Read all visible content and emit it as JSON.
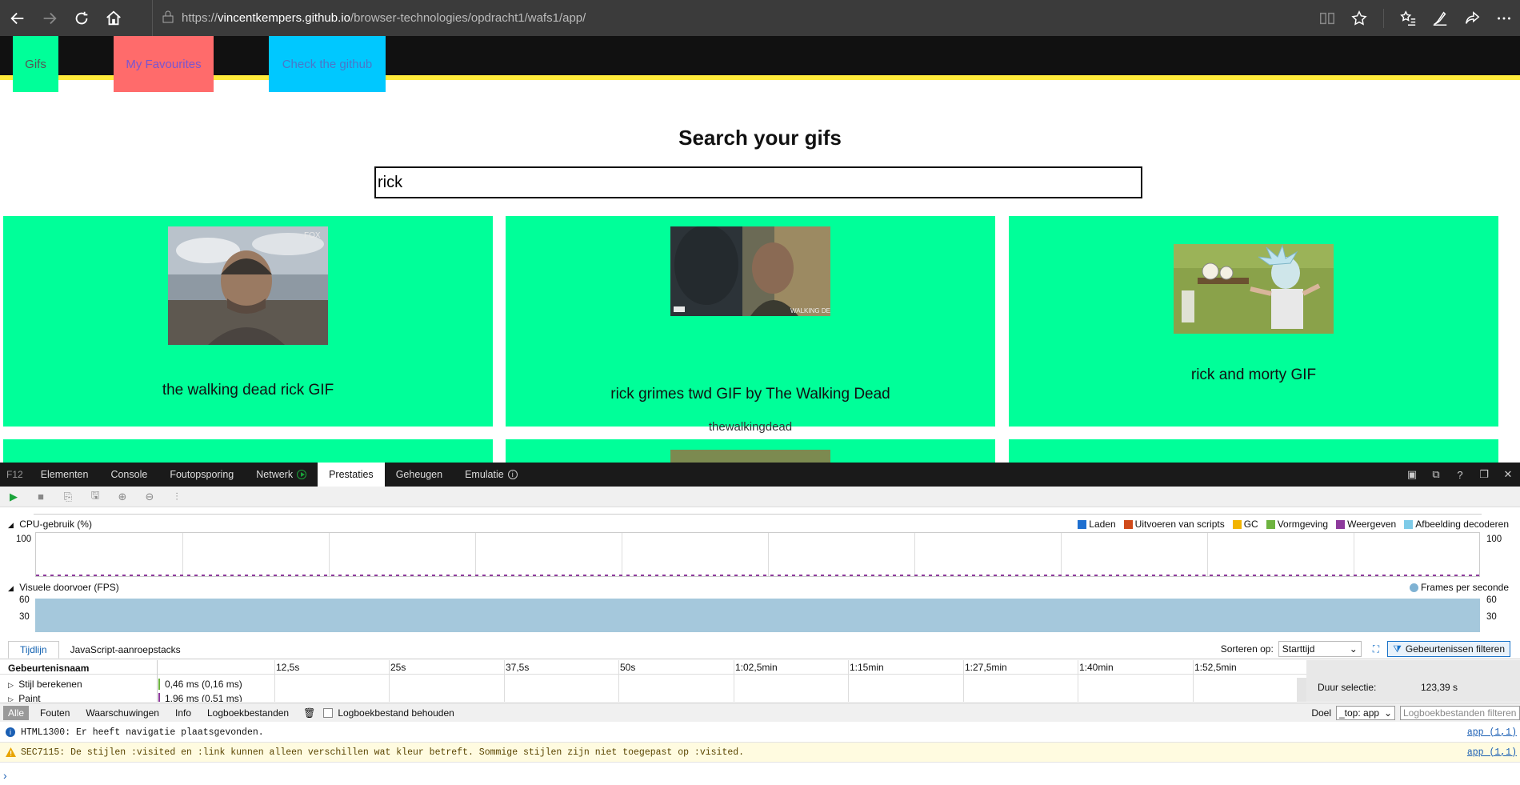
{
  "browser": {
    "url_prefix": "https://",
    "url_host": "vincentkempers.github.io",
    "url_path": "/browser-technologies/opdracht1/wafs1/app/"
  },
  "app": {
    "nav": {
      "gifs": "Gifs",
      "favourites": "My Favourites",
      "github": "Check the github"
    },
    "search_title": "Search your gifs",
    "search_value": "rick",
    "cards": [
      {
        "title": "the walking dead rick GIF",
        "user": ""
      },
      {
        "title": "rick grimes twd GIF by The Walking Dead",
        "user": "thewalkingdead"
      },
      {
        "title": "rick and morty GIF",
        "user": ""
      }
    ]
  },
  "devtools": {
    "f12": "F12",
    "tabs": [
      "Elementen",
      "Console",
      "Foutopsporing",
      "Netwerk",
      "Prestaties",
      "Geheugen",
      "Emulatie"
    ],
    "active_tab": "Prestaties",
    "cpu_label": "CPU-gebruik (%)",
    "cpu_max": "100",
    "legend": [
      {
        "label": "Laden",
        "color": "#1e6fd0"
      },
      {
        "label": "Uitvoeren van scripts",
        "color": "#d04a1a"
      },
      {
        "label": "GC",
        "color": "#f2b400"
      },
      {
        "label": "Vormgeving",
        "color": "#6db33f"
      },
      {
        "label": "Weergeven",
        "color": "#8d3a9c"
      },
      {
        "label": "Afbeelding decoderen",
        "color": "#7ecbe8"
      }
    ],
    "fps_label": "Visuele doorvoer (FPS)",
    "fps_legend": "Frames per seconde",
    "fps_top": "60",
    "fps_mid": "30",
    "subtabs": [
      "Tijdlijn",
      "JavaScript-aanroepstacks"
    ],
    "sort_label": "Sorteren op:",
    "sort_value": "Starttijd",
    "filter_events": "Gebeurtenissen filteren",
    "event_name_header": "Gebeurtenisnaam",
    "ticks": [
      "12,5s",
      "25s",
      "37,5s",
      "50s",
      "1:02,5min",
      "1:15min",
      "1:27,5min",
      "1:40min",
      "1:52,5min"
    ],
    "events": [
      {
        "name": "Stijl berekenen",
        "value": "0,46 ms (0,16 ms)",
        "color": "#6db33f"
      },
      {
        "name": "Paint",
        "value": "1,96 ms (0,51 ms)",
        "color": "#8d3a9c"
      }
    ],
    "duration_label": "Duur selectie:",
    "duration_value": "123,39 s",
    "console_filters": [
      "Alle",
      "Fouten",
      "Waarschuwingen",
      "Info",
      "Logboekbestanden"
    ],
    "keep_log": "Logboekbestand behouden",
    "doel_label": "Doel",
    "doel_value": "_top: app",
    "log_filter_placeholder": "Logboekbestanden filteren",
    "logs": [
      {
        "type": "info",
        "text": "HTML1300: Er heeft navigatie plaatsgevonden.",
        "src": "app (1,1)"
      },
      {
        "type": "warn",
        "text": "SEC7115: De stijlen :visited en :link kunnen alleen verschillen wat kleur betreft. Sommige stijlen zijn niet toegepast op :visited.",
        "src": "app (1,1)"
      }
    ]
  }
}
